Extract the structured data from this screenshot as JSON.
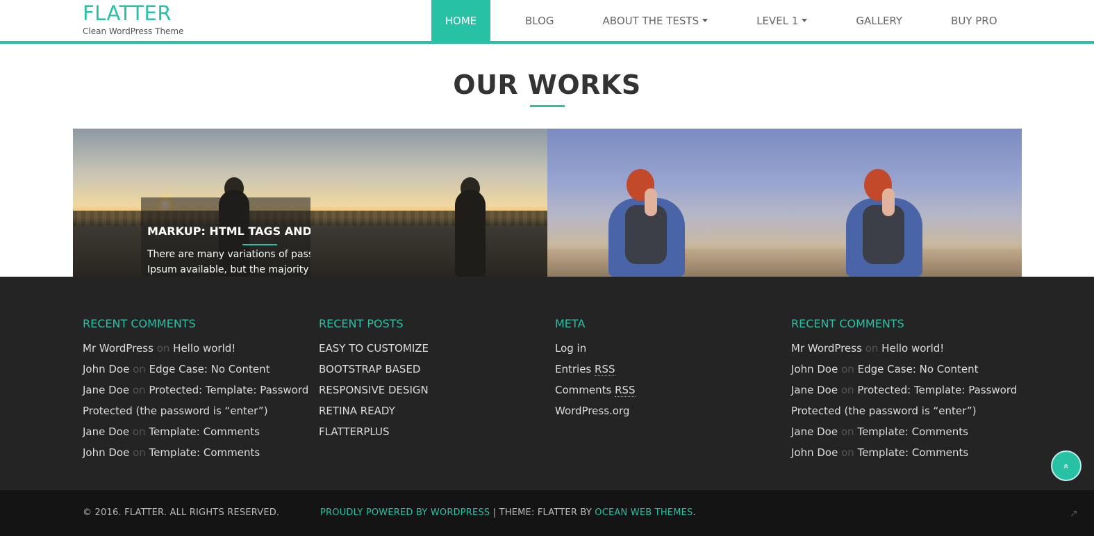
{
  "header": {
    "site_title": "FLATTER",
    "tagline": "Clean WordPress Theme",
    "nav": [
      {
        "label": "HOME",
        "active": true
      },
      {
        "label": "BLOG"
      },
      {
        "label": "ABOUT THE TESTS",
        "dropdown": true
      },
      {
        "label": "LEVEL 1",
        "dropdown": true
      },
      {
        "label": "GALLERY"
      },
      {
        "label": "BUY PRO"
      }
    ]
  },
  "works": {
    "title": "OUR WORKS",
    "overlay": {
      "title": "MARKUP: HTML TAGS AND FO",
      "line1": "There are many variations of passa",
      "line2": "Ipsum available, but the majority h"
    }
  },
  "footer": {
    "recent_comments_1": {
      "title": "RECENT COMMENTS",
      "items": [
        {
          "author": "Mr WordPress",
          "on": "on",
          "post": "Hello world!"
        },
        {
          "author": "John Doe",
          "on": "on",
          "post": "Edge Case: No Content"
        },
        {
          "author": "Jane Doe",
          "on": "on",
          "post": "Protected: Template: Password Protected (the password is “enter”)"
        },
        {
          "author": "Jane Doe",
          "on": "on",
          "post": "Template: Comments"
        },
        {
          "author": "John Doe",
          "on": "on",
          "post": "Template: Comments"
        }
      ]
    },
    "recent_posts": {
      "title": "RECENT POSTS",
      "items": [
        "EASY TO CUSTOMIZE",
        "BOOTSTRAP BASED",
        "RESPONSIVE DESIGN",
        "RETINA READY",
        "FLATTERPLUS"
      ]
    },
    "meta": {
      "title": "META",
      "log_in": "Log in",
      "entries": "Entries",
      "comments": "Comments",
      "rss": "RSS",
      "wordpress_org": "WordPress.org"
    },
    "recent_comments_2": {
      "title": "RECENT COMMENTS",
      "items": [
        {
          "author": "Mr WordPress",
          "on": "on",
          "post": "Hello world!"
        },
        {
          "author": "John Doe",
          "on": "on",
          "post": "Edge Case: No Content"
        },
        {
          "author": "Jane Doe",
          "on": "on",
          "post": "Protected: Template: Password Protected (the password is “enter”)"
        },
        {
          "author": "Jane Doe",
          "on": "on",
          "post": "Template: Comments"
        },
        {
          "author": "John Doe",
          "on": "on",
          "post": "Template: Comments"
        }
      ]
    },
    "scroll_top_icon": "»"
  },
  "bottom": {
    "copyright": "© 2016. FLATTER. ALL RIGHTS RESERVED.",
    "powered": "PROUDLY POWERED BY WORDPRESS",
    "separator": " | THEME: FLATTER BY ",
    "theme_author": "OCEAN WEB THEMES",
    "period": "."
  },
  "colors": {
    "accent": "#27c1a6",
    "footer_bg": "#242424",
    "bottom_bg": "#141414"
  }
}
